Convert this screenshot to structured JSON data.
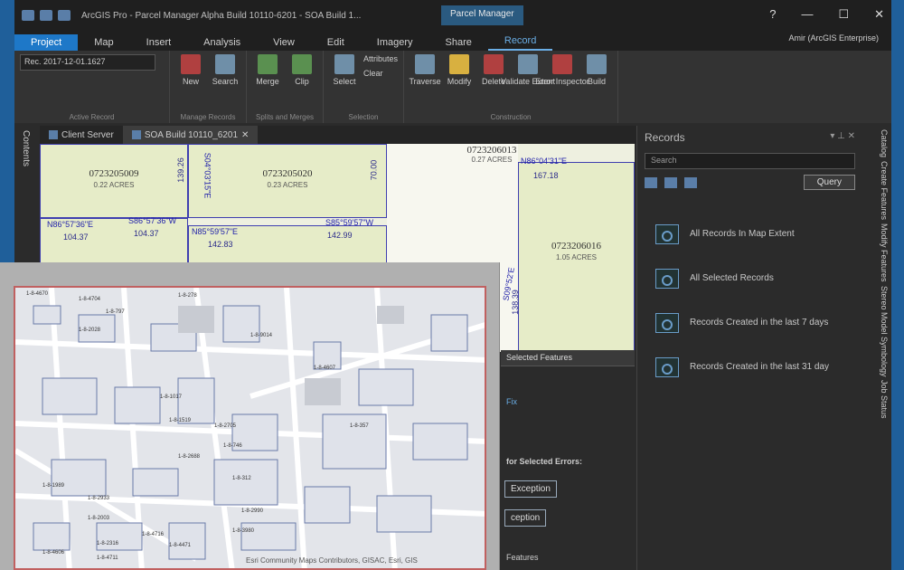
{
  "window": {
    "title": "ArcGIS Pro - Parcel Manager Alpha Build 10110-6201 - SOA Build 1...",
    "context_tab": "Parcel Manager",
    "controls": [
      "?",
      "—",
      "☐",
      "✕"
    ]
  },
  "ribbon_tabs": [
    "Project",
    "Map",
    "Insert",
    "Analysis",
    "View",
    "Edit",
    "Imagery",
    "Share",
    "Record"
  ],
  "user": "Amir (ArcGIS Enterprise)",
  "ribbon": {
    "active_record": "Rec. 2017-12-01.1627",
    "groups": [
      {
        "label": "Active Record",
        "buttons": []
      },
      {
        "label": "Manage Records",
        "buttons": [
          "New",
          "Search"
        ]
      },
      {
        "label": "Splits and Merges",
        "buttons": [
          "Merge",
          "Clip"
        ]
      },
      {
        "label": "Selection",
        "buttons": [
          "Select"
        ],
        "small": [
          "Attributes",
          "Clear"
        ]
      },
      {
        "label": "Construction",
        "buttons": [
          "Traverse",
          "Modify",
          "Delete",
          "Validate Extent",
          "Error Inspector",
          "Build"
        ]
      }
    ]
  },
  "left_panel": "Contents",
  "doc_tabs": [
    "Client Server",
    "SOA Build 10110_6201"
  ],
  "map": {
    "parcels": [
      {
        "num": "0723205009",
        "acres": "0.22 ACRES"
      },
      {
        "num": "0723205020",
        "acres": "0.23 ACRES"
      },
      {
        "num": "0723206013",
        "acres": "0.27 ACRES"
      },
      {
        "num": "0723206016",
        "acres": "1.05 ACRES"
      }
    ],
    "dims": [
      "139.26",
      "70.00",
      "104.37",
      "104.37",
      "142.83",
      "142.99",
      "167.18",
      "138.39"
    ],
    "bearings": [
      "S04°03'15\"E",
      "N86°57'36\"E",
      "S86°57'36\"W",
      "N85°59'57\"E",
      "S85°59'57\"W",
      "N86°04'31\"E",
      "S09°52'E"
    ]
  },
  "records_pane": {
    "title": "Records",
    "search_placeholder": "Search",
    "query_label": "Query",
    "items": [
      "All Records In Map Extent",
      "All Selected Records",
      "Records Created in the last 7 days",
      "Records Created in the last 31 day"
    ]
  },
  "right_side_tabs": [
    "Catalog",
    "Create Features",
    "Modify Features",
    "Stereo Model Symbology",
    "Job Status"
  ],
  "bottom_pane": {
    "tab": "Selected Features",
    "link": "Fix",
    "heading": "for Selected Errors:",
    "buttons": [
      "Exception",
      "ception"
    ],
    "footer": "Features"
  },
  "overlay": {
    "labels": [
      "1-8-4670",
      "1-8-4704",
      "1-8-2028",
      "1-8-797",
      "1-8-278",
      "1-8-9014",
      "1-8-4607",
      "1-8-1017",
      "1-8-1519",
      "1-8-2705",
      "1-8-746",
      "1-8-2688",
      "1-8-312",
      "1-8-2990",
      "1-8-357",
      "1-8-3980",
      "1-8-4471",
      "1-8-2316",
      "1-8-1989",
      "1-8-2933",
      "1-8-2003",
      "1-8-4606",
      "1-8-4711",
      "1-8-4716"
    ],
    "credit": "Esri Community Maps Contributors, GISAC, Esri, GIS"
  }
}
